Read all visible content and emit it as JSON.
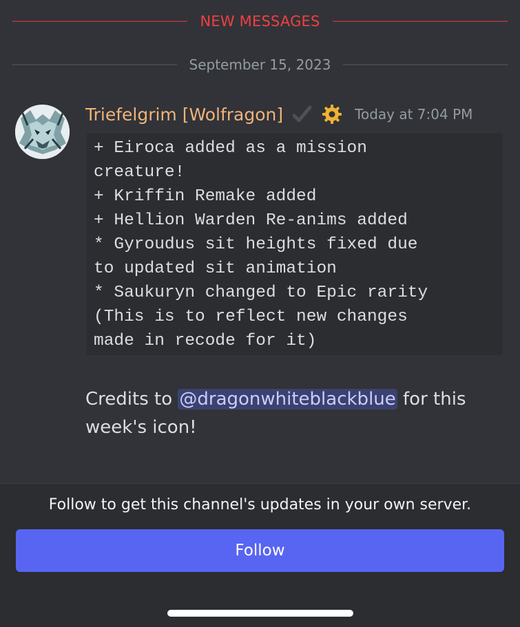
{
  "dividers": {
    "new_messages": "NEW MESSAGES",
    "date": "September 15, 2023"
  },
  "message": {
    "author": "Triefelgrim [Wolfragon]",
    "timestamp": "Today at 7:04 PM",
    "icons": [
      "verified-check-icon",
      "gear-icon"
    ],
    "code_lines": [
      "+ Eiroca added as a mission",
      "creature!",
      "+ Kriffin Remake added",
      "+ Hellion Warden Re-anims added",
      "* Gyroudus sit heights fixed due",
      "to updated sit animation",
      "* Saukuryn changed to Epic rarity",
      "(This is to reflect new changes",
      "made in recode for it)"
    ],
    "credits_prefix": "Credits to ",
    "mention": "@dragonwhiteblackblue",
    "credits_suffix": " for this week's icon!"
  },
  "footer": {
    "follow_text": "Follow to get this channel's updates in your own server.",
    "follow_button": "Follow"
  },
  "colors": {
    "background": "#313338",
    "author": "#f0b27a",
    "new_messages": "#f23f43",
    "follow_button": "#5865f2",
    "mention_bg": "#3c4270"
  }
}
